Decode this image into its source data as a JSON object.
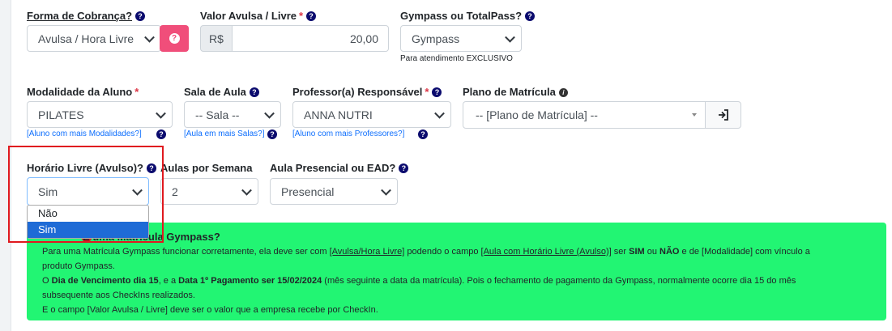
{
  "row1": {
    "forma_label": "Forma de Cobrança?",
    "forma_value": "Avulsa / Hora Livre",
    "valor_label": "Valor Avulsa / Livre",
    "valor_prefix": "R$",
    "valor_value": "20,00",
    "gympass_label": "Gympass ou TotalPass?",
    "gympass_value": "Gympass",
    "gympass_note": "Para atendimento EXCLUSIVO"
  },
  "row2": {
    "modalidade_label": "Modalidade da Aluno",
    "modalidade_value": "PILATES",
    "modalidade_link": "[Aluno com mais Modalidades?]",
    "sala_label": "Sala de Aula",
    "sala_value": "-- Sala --",
    "sala_link": "[Aula em mais Salas?]",
    "professor_label": "Professor(a) Responsável",
    "professor_value": "ANNA NUTRI",
    "professor_link": "[Aluno com mais Professores?]",
    "plano_label": "Plano de Matrícula",
    "plano_value": "-- [Plano de Matrícula] --"
  },
  "row3": {
    "horario_label": "Horário Livre (Avulso)?",
    "horario_value": "Sim",
    "horario_options": [
      "Não",
      "Sim"
    ],
    "aulas_label": "Aulas por Semana",
    "aulas_value": "2",
    "presencial_label": "Aula Presencial ou EAD?",
    "presencial_value": "Presencial"
  },
  "alert": {
    "title": "É uma Matrícula Gympass?",
    "l1_a": "Para uma Matrícula Gympass funcionar corretamente, ela deve ser com ",
    "l1_b": "[Avulsa/Hora Livre]",
    "l1_c": " podendo o campo ",
    "l1_d": "[Aula com Horário Livre (Avulso)]",
    "l1_e": " ser ",
    "l1_f": "SIM",
    "l1_g": " ou ",
    "l1_h": "NÃO",
    "l1_i": " e de [Modalidade] com vínculo a",
    "l2": "produto Gympass.",
    "l3_a": "O ",
    "l3_b": "Dia de Vencimento dia 15",
    "l3_c": ", e a ",
    "l3_d": "Data 1º Pagamento ser 15/02/2024",
    "l3_e": " (mês seguinte a data da matrícula). Pois o fechamento de pagamento da Gympass, normalmente ocorre dia 15 do mês",
    "l4": "subsequente aos CheckIns realizados.",
    "l5": "E o campo [Valor Avulsa / Livre] deve ser o valor que a empresa recebe por CheckIn."
  },
  "colors": {
    "alert_bg": "#22f573",
    "danger": "#dc3545",
    "pink": "#f04e7a",
    "highlight": "#e0191f",
    "selected": "#1e6bd6"
  }
}
